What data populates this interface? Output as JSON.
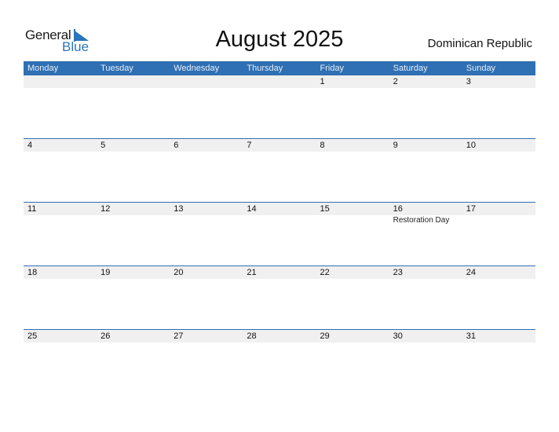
{
  "logo": {
    "line1": "General",
    "line2": "Blue"
  },
  "title": "August 2025",
  "country": "Dominican Republic",
  "colors": {
    "accent": "#2f6fb3",
    "date_strip": "#f0f0f0"
  },
  "weekdays": [
    "Monday",
    "Tuesday",
    "Wednesday",
    "Thursday",
    "Friday",
    "Saturday",
    "Sunday"
  ],
  "weeks": [
    {
      "days": [
        "",
        "",
        "",
        "",
        "1",
        "2",
        "3"
      ],
      "holidays": [
        "",
        "",
        "",
        "",
        "",
        "",
        ""
      ]
    },
    {
      "days": [
        "4",
        "5",
        "6",
        "7",
        "8",
        "9",
        "10"
      ],
      "holidays": [
        "",
        "",
        "",
        "",
        "",
        "",
        ""
      ]
    },
    {
      "days": [
        "11",
        "12",
        "13",
        "14",
        "15",
        "16",
        "17"
      ],
      "holidays": [
        "",
        "",
        "",
        "",
        "",
        "Restoration Day",
        ""
      ]
    },
    {
      "days": [
        "18",
        "19",
        "20",
        "21",
        "22",
        "23",
        "24"
      ],
      "holidays": [
        "",
        "",
        "",
        "",
        "",
        "",
        ""
      ]
    },
    {
      "days": [
        "25",
        "26",
        "27",
        "28",
        "29",
        "30",
        "31"
      ],
      "holidays": [
        "",
        "",
        "",
        "",
        "",
        "",
        ""
      ]
    }
  ]
}
